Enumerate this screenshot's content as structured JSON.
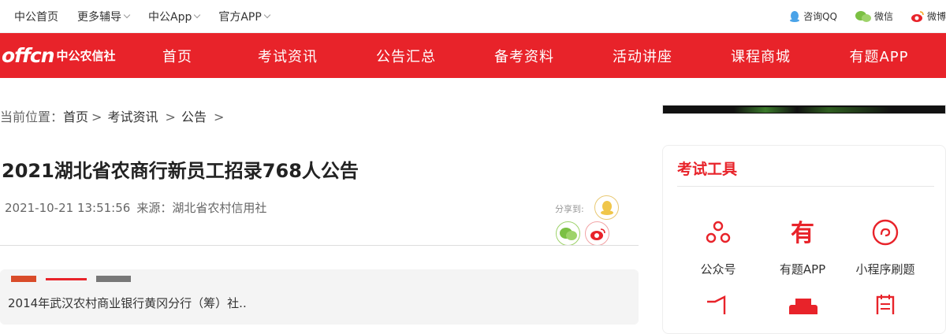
{
  "topbar": {
    "left": [
      {
        "label": "中公首页",
        "caret": false
      },
      {
        "label": "更多辅导",
        "caret": true
      },
      {
        "label": "中公App",
        "caret": true
      },
      {
        "label": "官方APP",
        "caret": true
      }
    ],
    "right": [
      {
        "label": "咨询QQ",
        "icon": "qq-icon"
      },
      {
        "label": "微信",
        "icon": "wechat-icon"
      },
      {
        "label": "微博",
        "icon": "weibo-icon"
      }
    ]
  },
  "nav": {
    "logo_en": "offcn",
    "logo_cn": "中公农信社",
    "items": [
      "首页",
      "考试资讯",
      "公告汇总",
      "备考资料",
      "活动讲座",
      "课程商城",
      "有题APP"
    ]
  },
  "breadcrumb": {
    "prefix": "当前位置：",
    "items": [
      "首页",
      "考试资讯",
      "公告"
    ]
  },
  "article": {
    "title": "2021湖北省农商行新员工招录768人公告",
    "date": "2021-10-21 13:51:56",
    "source": "来源：湖北省农村信用社",
    "share_label": "分享到:"
  },
  "related": {
    "text": "2014年武汉农村商业银行黄冈分行（筹）社.."
  },
  "tools": {
    "title": "考试工具",
    "items": [
      {
        "label": "公众号",
        "icon": "official-account-icon"
      },
      {
        "label": "有题APP",
        "icon": "youti-app-icon"
      },
      {
        "label": "小程序刷题",
        "icon": "mini-program-icon"
      }
    ]
  },
  "colors": {
    "brand_red": "#e8232a"
  }
}
